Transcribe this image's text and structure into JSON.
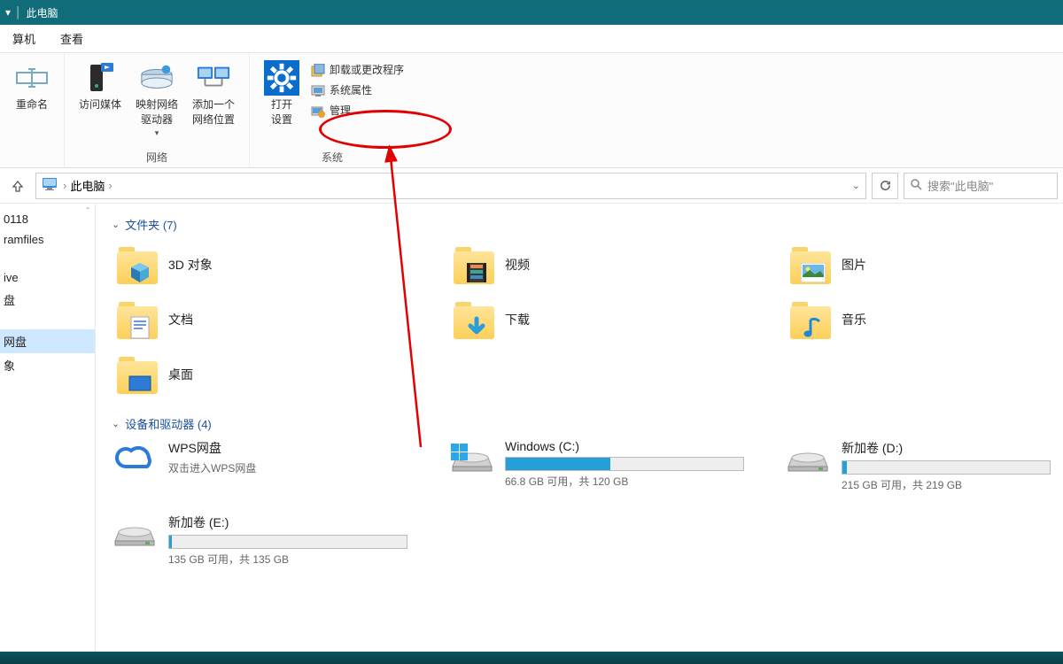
{
  "titlebar": {
    "location": "此电脑"
  },
  "tabs": {
    "computer": "算机",
    "view": "查看"
  },
  "ribbon": {
    "rename": "重命名",
    "access_media": "访问媒体",
    "map_drive": "映射网络\n驱动器",
    "add_net": "添加一个\n网络位置",
    "network_label": "网络",
    "open_settings": "打开\n设置",
    "uninstall": "卸载或更改程序",
    "sys_props": "系统属性",
    "manage": "管理",
    "system_label": "系统"
  },
  "address": {
    "location": "此电脑",
    "search_placeholder": "搜索\"此电脑\""
  },
  "sidebar": {
    "items": [
      "0118",
      "ramfiles",
      "",
      "ive",
      "盘",
      "",
      "网盘",
      "象"
    ]
  },
  "sections": {
    "folders": {
      "title": "文件夹",
      "count": 7
    },
    "drives": {
      "title": "设备和驱动器",
      "count": 4
    }
  },
  "folders": [
    {
      "name": "3D 对象",
      "overlay": "cube"
    },
    {
      "name": "视频",
      "overlay": "film"
    },
    {
      "name": "图片",
      "overlay": "photo"
    },
    {
      "name": "文档",
      "overlay": "doc"
    },
    {
      "name": "下载",
      "overlay": "arrow"
    },
    {
      "name": "音乐",
      "overlay": "note"
    },
    {
      "name": "桌面",
      "overlay": "desk"
    }
  ],
  "drives": [
    {
      "name": "WPS网盘",
      "sub": "双击进入WPS网盘",
      "type": "cloud"
    },
    {
      "name": "Windows (C:)",
      "sub": "66.8 GB 可用，共 120 GB",
      "type": "disk",
      "fill": 44
    },
    {
      "name": "新加卷 (D:)",
      "sub": "215 GB 可用，共 219 GB",
      "type": "disk",
      "fill": 2
    },
    {
      "name": "新加卷 (E:)",
      "sub": "135 GB 可用，共 135 GB",
      "type": "disk",
      "fill": 1
    }
  ]
}
